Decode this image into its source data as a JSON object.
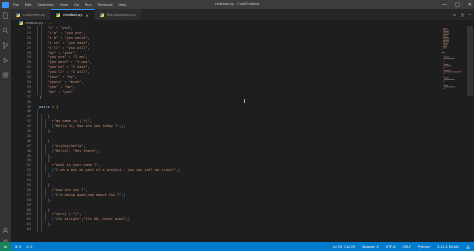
{
  "titlebar": {
    "menu": [
      "File",
      "Edit",
      "Selection",
      "View",
      "Go",
      "Run",
      "Terminal",
      "Help"
    ],
    "title": "chatbot.py - CustChatbot",
    "controls": {
      "minimize": "—",
      "maximize": "□",
      "close": "✕"
    }
  },
  "activitybar": {
    "icons": [
      "files-icon",
      "search-icon",
      "source-control-icon",
      "run-debug-icon",
      "extensions-icon"
    ],
    "bottom_icons": [
      "account-icon",
      "settings-gear-icon"
    ]
  },
  "tabs": [
    {
      "label": "customer.py",
      "active": false
    },
    {
      "label": "chatbot.py",
      "active": true,
      "close": "×"
    },
    {
      "label": "file-organizer.py",
      "active": false
    }
  ],
  "breadcrumb": {
    "file": "chatbot.py",
    "separator": "›",
    "symbol": "..."
  },
  "editor": {
    "lines": [
      {
        "n": "23",
        "indent": 6,
        "tokens": [
          [
            "s",
            "\"i\""
          ],
          [
            "p",
            " : "
          ],
          [
            "s",
            "\"you\""
          ],
          [
            "p",
            ","
          ]
        ]
      },
      {
        "n": "24",
        "indent": 6,
        "tokens": [
          [
            "s",
            "\"i'm\""
          ],
          [
            "p",
            " : "
          ],
          [
            "s",
            "\"you are\""
          ],
          [
            "p",
            ","
          ]
        ]
      },
      {
        "n": "25",
        "indent": 6,
        "tokens": [
          [
            "s",
            "\"i'd\""
          ],
          [
            "p",
            " : "
          ],
          [
            "s",
            "\"you would\""
          ],
          [
            "p",
            ","
          ]
        ]
      },
      {
        "n": "26",
        "indent": 6,
        "tokens": [
          [
            "s",
            "\"i've\""
          ],
          [
            "p",
            " : "
          ],
          [
            "s",
            "\"you have\""
          ],
          [
            "p",
            ","
          ]
        ]
      },
      {
        "n": "27",
        "indent": 6,
        "tokens": [
          [
            "s",
            "\"i'll\""
          ],
          [
            "p",
            " : "
          ],
          [
            "s",
            "\"you will\""
          ],
          [
            "p",
            ","
          ]
        ]
      },
      {
        "n": "28",
        "indent": 6,
        "tokens": [
          [
            "s",
            "\"my\""
          ],
          [
            "p",
            " : "
          ],
          [
            "s",
            "\"your\""
          ],
          [
            "p",
            ","
          ]
        ]
      },
      {
        "n": "29",
        "indent": 6,
        "tokens": [
          [
            "s",
            "\"you are\""
          ],
          [
            "p",
            " : "
          ],
          [
            "s",
            "\"I am\""
          ],
          [
            "p",
            ","
          ]
        ]
      },
      {
        "n": "30",
        "indent": 6,
        "tokens": [
          [
            "s",
            "\"you were\""
          ],
          [
            "p",
            " : "
          ],
          [
            "s",
            "\"I was\""
          ],
          [
            "p",
            ","
          ]
        ]
      },
      {
        "n": "31",
        "indent": 6,
        "tokens": [
          [
            "s",
            "\"you've\""
          ],
          [
            "p",
            " : "
          ],
          [
            "s",
            "\"I have\""
          ],
          [
            "p",
            ","
          ]
        ]
      },
      {
        "n": "32",
        "indent": 6,
        "tokens": [
          [
            "s",
            "\"you'll\""
          ],
          [
            "p",
            " : "
          ],
          [
            "s",
            "\"I will\""
          ],
          [
            "p",
            ","
          ]
        ]
      },
      {
        "n": "33",
        "indent": 6,
        "tokens": [
          [
            "s",
            "\"your\""
          ],
          [
            "p",
            " : "
          ],
          [
            "s",
            "\"my\""
          ],
          [
            "p",
            ","
          ]
        ]
      },
      {
        "n": "34",
        "indent": 6,
        "tokens": [
          [
            "s",
            "\"yours\""
          ],
          [
            "p",
            " : "
          ],
          [
            "s",
            "\"mine\""
          ],
          [
            "p",
            ","
          ]
        ]
      },
      {
        "n": "35",
        "indent": 6,
        "tokens": [
          [
            "s",
            "\"you\""
          ],
          [
            "p",
            " : "
          ],
          [
            "s",
            "\"me\""
          ],
          [
            "p",
            ","
          ]
        ]
      },
      {
        "n": "36",
        "indent": 6,
        "tokens": [
          [
            "s",
            "\"me\""
          ],
          [
            "p",
            " : "
          ],
          [
            "s",
            "\"you\""
          ]
        ]
      },
      {
        "n": "37",
        "indent": 2,
        "tokens": [
          [
            "b1",
            "}"
          ]
        ]
      },
      {
        "n": "38",
        "indent": 0,
        "tokens": []
      },
      {
        "n": "39",
        "indent": 2,
        "tokens": [
          [
            "v",
            "pairs"
          ],
          [
            "p",
            " = "
          ],
          [
            "b1",
            "["
          ]
        ]
      },
      {
        "n": "40",
        "indent": 4,
        "tokens": []
      },
      {
        "n": "41",
        "indent": 6,
        "tokens": [
          [
            "b2",
            "["
          ]
        ]
      },
      {
        "n": "42",
        "indent": 8,
        "tokens": [
          [
            "s",
            "r\"my name is (.*)\""
          ],
          [
            "p",
            ","
          ]
        ]
      },
      {
        "n": "43",
        "indent": 8,
        "tokens": [
          [
            "b3",
            "["
          ],
          [
            "s",
            "\"Hello %1, How are you today ?\""
          ],
          [
            "p",
            ","
          ],
          [
            "b3",
            "]"
          ],
          [
            "p",
            ","
          ]
        ]
      },
      {
        "n": "44",
        "indent": 6,
        "tokens": [
          [
            "b2",
            "]"
          ],
          [
            "p",
            ","
          ]
        ]
      },
      {
        "n": "45",
        "indent": 6,
        "tokens": []
      },
      {
        "n": "46",
        "indent": 6,
        "tokens": [
          [
            "b2",
            "["
          ]
        ]
      },
      {
        "n": "47",
        "indent": 8,
        "tokens": [
          [
            "s",
            "r\"hi|hey|hello\""
          ],
          [
            "p",
            ","
          ]
        ]
      },
      {
        "n": "48",
        "indent": 8,
        "tokens": [
          [
            "b3",
            "["
          ],
          [
            "s",
            "\"Hello\""
          ],
          [
            "p",
            ", "
          ],
          [
            "s",
            "\"Hey there\""
          ],
          [
            "b3",
            "]"
          ],
          [
            "p",
            ","
          ]
        ]
      },
      {
        "n": "49",
        "indent": 6,
        "tokens": [
          [
            "b2",
            "]"
          ],
          [
            "p",
            ","
          ]
        ]
      },
      {
        "n": "50",
        "indent": 6,
        "tokens": [
          [
            "b2",
            "["
          ]
        ]
      },
      {
        "n": "51",
        "indent": 8,
        "tokens": [
          [
            "s",
            "r\"what is your name ?\""
          ],
          [
            "p",
            ","
          ]
        ]
      },
      {
        "n": "52",
        "indent": 8,
        "tokens": [
          [
            "b3",
            "["
          ],
          [
            "s",
            "\"I am a bot an part of a project . you can call me crazy!\""
          ],
          [
            "p",
            ","
          ],
          [
            "b3",
            "]"
          ]
        ]
      },
      {
        "n": "53",
        "indent": 6,
        "tokens": [
          [
            "b2",
            "]"
          ],
          [
            "p",
            ","
          ]
        ]
      },
      {
        "n": "54",
        "indent": 6,
        "tokens": []
      },
      {
        "n": "55",
        "indent": 6,
        "tokens": [
          [
            "b2",
            "["
          ]
        ]
      },
      {
        "n": "56",
        "indent": 8,
        "tokens": [
          [
            "s",
            "r\"how are you ?\""
          ],
          [
            "p",
            ","
          ]
        ]
      },
      {
        "n": "57",
        "indent": 8,
        "tokens": [
          [
            "b3",
            "["
          ],
          [
            "s",
            "\"I'm doing good,now about You ?\""
          ],
          [
            "p",
            ","
          ],
          [
            "b3",
            "]"
          ]
        ]
      },
      {
        "n": "58",
        "indent": 6,
        "tokens": [
          [
            "b2",
            "]"
          ],
          [
            "p",
            ","
          ]
        ]
      },
      {
        "n": "59",
        "indent": 6,
        "tokens": []
      },
      {
        "n": "60",
        "indent": 6,
        "tokens": [
          [
            "b2",
            "["
          ]
        ]
      },
      {
        "n": "61",
        "indent": 8,
        "tokens": [
          [
            "s",
            "r\"sorry (.*)\""
          ],
          [
            "p",
            ","
          ]
        ]
      },
      {
        "n": "62",
        "indent": 8,
        "tokens": [
          [
            "b3",
            "["
          ],
          [
            "s",
            "\"Its alright\""
          ],
          [
            "p",
            ","
          ],
          [
            "s",
            "\"Its OK, never mind\""
          ],
          [
            "p",
            ","
          ],
          [
            "b3",
            "]"
          ]
        ]
      },
      {
        "n": "63",
        "indent": 6,
        "tokens": [
          [
            "b2",
            "]"
          ],
          [
            "p",
            ","
          ]
        ]
      },
      {
        "n": "64",
        "indent": 6,
        "tokens": []
      }
    ]
  },
  "colors": {
    "accent": "#007acc",
    "string": "#ce9178",
    "variable": "#9cdcfe",
    "bracket_1": "#ffd700",
    "bracket_2": "#da70d6",
    "bracket_3": "#179fff"
  },
  "statusbar": {
    "remote": "⇋",
    "errors": "⊗ 0",
    "warnings": "⚠ 0",
    "position": "Ln 55, Col 25",
    "spaces": "Spaces: 4",
    "encoding": "UTF-8",
    "eol": "CRLF",
    "language": "Python",
    "interpreter": "3.11.4 64-bit"
  }
}
